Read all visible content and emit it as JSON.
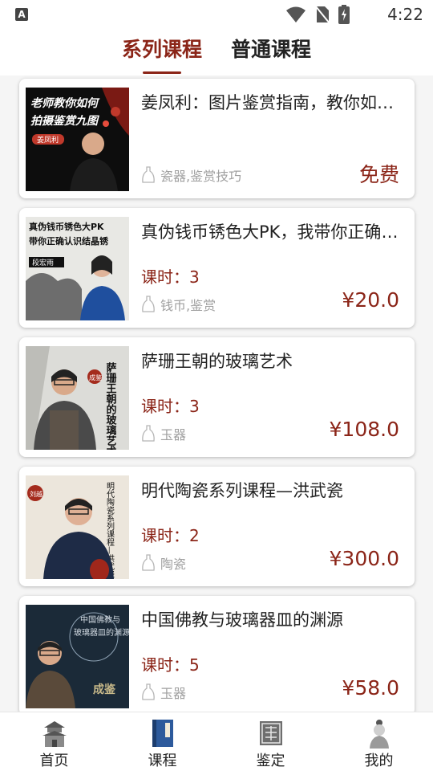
{
  "status": {
    "time": "4:22",
    "app_badge": "A"
  },
  "tabs": [
    {
      "label": "系列课程",
      "active": true
    },
    {
      "label": "普通课程",
      "active": false
    }
  ],
  "lessons_prefix": "课时：",
  "courses": [
    {
      "title": "姜凤利：图片鉴赏指南，教你如何拍摄鉴赏九图",
      "lessons": "",
      "tag": "瓷器,鉴赏技巧",
      "price": "免费",
      "thumb_text": [
        "老师教你如何",
        "拍摄鉴赏九图",
        "姜凤利"
      ]
    },
    {
      "title": "真伪钱币锈色大PK，我带你正确认识结晶锈",
      "lessons": "3",
      "tag": "钱币,鉴赏",
      "price": "¥20.0",
      "thumb_text": [
        "真伪钱币锈色大PK",
        "带你正确认识结晶锈",
        "段宏雨"
      ]
    },
    {
      "title": "萨珊王朝的玻璃艺术",
      "lessons": "3",
      "tag": "玉器",
      "price": "¥108.0",
      "thumb_text": [
        "萨珊王朝的玻璃艺术",
        "成鉴"
      ]
    },
    {
      "title": "明代陶瓷系列课程—洪武瓷",
      "lessons": "2",
      "tag": "陶瓷",
      "price": "¥300.0",
      "thumb_text": [
        "明代陶瓷系列课程—洪武瓷",
        "刘越"
      ]
    },
    {
      "title": "中国佛教与玻璃器皿的渊源",
      "lessons": "5",
      "tag": "玉器",
      "price": "¥58.0",
      "thumb_text": [
        "中国佛教与",
        "玻璃器皿的渊源",
        "成鉴"
      ]
    }
  ],
  "nav": [
    {
      "label": "首页",
      "icon": "temple-icon"
    },
    {
      "label": "课程",
      "icon": "book-icon"
    },
    {
      "label": "鉴定",
      "icon": "seal-icon"
    },
    {
      "label": "我的",
      "icon": "person-icon"
    }
  ],
  "colors": {
    "accent": "#8b2518",
    "tag_gray": "#a0a0a0"
  }
}
